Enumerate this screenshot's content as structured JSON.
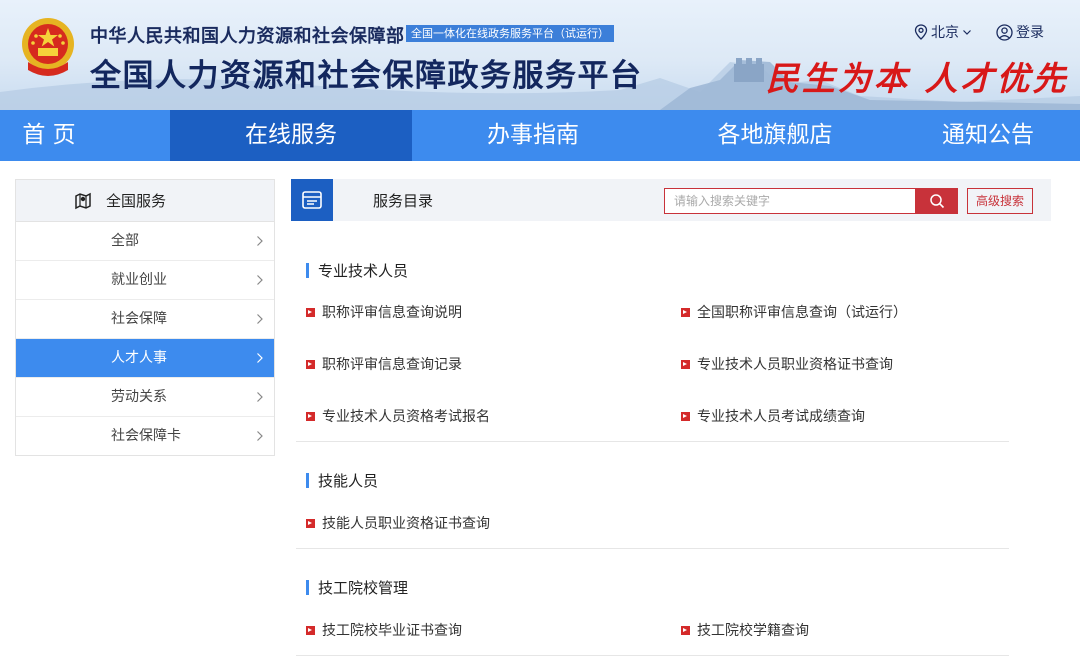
{
  "header": {
    "org_name": "中华人民共和国人力资源和社会保障部",
    "org_tag": "全国一体化在线政务服务平台（试运行）",
    "platform_title": "全国人力资源和社会保障政务服务平台",
    "slogan": "民生为本 人才优先",
    "location": "北京",
    "login": "登录"
  },
  "nav": {
    "items": [
      {
        "label": "首 页"
      },
      {
        "label": "在线服务"
      },
      {
        "label": "办事指南"
      },
      {
        "label": "各地旗舰店"
      },
      {
        "label": "通知公告"
      }
    ],
    "active_index": 1
  },
  "sidebar": {
    "title": "全国服务",
    "items": [
      {
        "label": "全部"
      },
      {
        "label": "就业创业"
      },
      {
        "label": "社会保障"
      },
      {
        "label": "人才人事"
      },
      {
        "label": "劳动关系"
      },
      {
        "label": "社会保障卡"
      }
    ],
    "active_index": 3
  },
  "main": {
    "title": "服务目录",
    "search_placeholder": "请输入搜索关键字",
    "advanced_search": "高级搜索",
    "sections": [
      {
        "title": "专业技术人员",
        "services": [
          "职称评审信息查询说明",
          "全国职称评审信息查询（试运行）",
          "职称评审信息查询记录",
          "专业技术人员职业资格证书查询",
          "专业技术人员资格考试报名",
          "专业技术人员考试成绩查询"
        ]
      },
      {
        "title": "技能人员",
        "services": [
          "技能人员职业资格证书查询"
        ]
      },
      {
        "title": "技工院校管理",
        "services": [
          "技工院校毕业证书查询",
          "技工院校学籍查询"
        ]
      }
    ]
  },
  "colors": {
    "nav_blue": "#3d8bee",
    "nav_active": "#1c5fc2",
    "accent_red": "#c8323a",
    "slogan_red": "#d81818"
  }
}
